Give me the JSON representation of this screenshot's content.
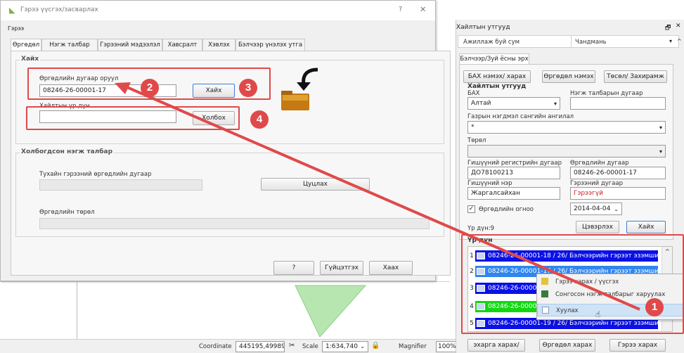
{
  "dialog": {
    "title": "Гэрээ үүсгэх/засварлах",
    "help": "?",
    "close": "✕",
    "menu": "Гэрээ",
    "tabs": [
      "Өргөдөл",
      "Нэгж талбар",
      "Гэрээний мэдээлэл",
      "Хавсралт",
      "Хэвлэх",
      "Бэлчээр үнэлэх утга"
    ],
    "search_group": "Хайх",
    "app_no_label": "Өргөдлийн дугаар оруул",
    "app_no_value": "08246-26-00001-17",
    "search_button": "Хайх",
    "result_label": "Хайлтын үр дүн",
    "result_value": "",
    "link_button": "Холбох",
    "related_group": "Холбогдсон нэгж талбар",
    "contract_app_label": "Тухайн гэрээний өргөдлийн дугаар",
    "unlink_button": "Цуцлах",
    "app_type_label": "Өргөдлийн төрөл",
    "help_button": "?",
    "finish_button": "Гүйцэтгэх",
    "close_button": "Хаах"
  },
  "status_bar": {
    "coordinate_label": "Coordinate",
    "coordinate_value": "445195,4998976",
    "scale_label": "Scale",
    "scale_value": "1:634,740",
    "magnifier_label": "Magnifier",
    "magnifier_value": "100%"
  },
  "panel": {
    "title": "Хайлтын утгууд",
    "float_icon": "🗗",
    "close_icon": "✕",
    "working_sum_label": "Ажиллаж буй сум",
    "working_sum_value": "Чандмань",
    "subtab": "Бэлчээр/Зуй ёсны эрх",
    "btn_bah": "БАХ нэмэх/ харах",
    "btn_app": "Өргөдөл нэмэх",
    "btn_plan": "Төсөл/ Захирамж",
    "search_title": "Хайлтын утгууд",
    "bah_label": "БАХ",
    "bah_value": "Алтай",
    "parcel_label": "Нэгж талбарын дугаар",
    "parcel_value": "",
    "land_class_label": "Газрын нэгдмэл сангийн ангилал",
    "land_class_value": "*",
    "type_label": "Төрөл",
    "type_value": "",
    "reg_label": "Гишүүний регистрийн дугаар",
    "reg_value": "ДО78100213",
    "appno_label": "Өргөдлийн дугаар",
    "appno_value": "08246-26-00001-17",
    "name_label": "Гишүүний нэр",
    "name_value": "Жаргалсайхан",
    "contract_no_label": "Гэрээний дугаар",
    "contract_no_value": "Гэрээгүй",
    "date_check_label": "Өргөдлийн огноо",
    "date_value": "2014-04-04",
    "result_count": "Үр дүн:9",
    "clear_button": "Цэвэрлэх",
    "search_button": "Хайх",
    "results_title": "Үр дүн",
    "rows": [
      {
        "num": "1",
        "text": "08246-26-00001-18 / 26/ Бэлчээрийн гэрээт эзэмшигч уед з",
        "color": "#0a10e6"
      },
      {
        "num": "2",
        "text": "08246-26-00001-17 / 26/ Бэлчээрийн гэрээт эзэмшигч уед з",
        "color": "#2f86ee"
      },
      {
        "num": "3",
        "text": "08246-26-0000",
        "color": "#0a10e6"
      },
      {
        "num": "4",
        "text": "08246-26-0000",
        "color": "#10d810"
      },
      {
        "num": "5",
        "text": "08246-26-00001-19 / 26/ Бэлчээрийн гэрээт эзэмшигч уед з",
        "color": "#0a10e6"
      }
    ],
    "bottom_btn_1": "эхарга харах/ хаі",
    "bottom_btn_2": "Өргөдөл харах",
    "bottom_btn_3": "Гэрээ харах"
  },
  "context_menu": {
    "items": [
      "Гэрээ харах / үүсгэх",
      "Сонгосон нэгж талбарыг харуулах",
      "Хуулах"
    ]
  },
  "callouts": [
    "1",
    "2",
    "3",
    "4"
  ],
  "colors": {
    "accent_red": "#e0494a",
    "selection_blue": "#0a10e6",
    "polygon_green": "#b5e8b0"
  }
}
